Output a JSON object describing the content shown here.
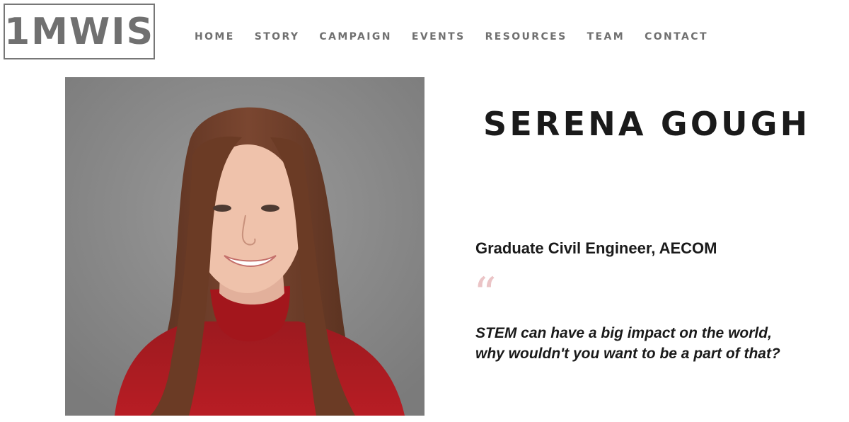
{
  "header": {
    "logo_text": "1MWIS",
    "nav": [
      {
        "label": "HOME"
      },
      {
        "label": "STORY"
      },
      {
        "label": "CAMPAIGN"
      },
      {
        "label": "EVENTS"
      },
      {
        "label": "RESOURCES"
      },
      {
        "label": "TEAM"
      },
      {
        "label": "CONTACT"
      }
    ]
  },
  "profile": {
    "name": "SERENA GOUGH",
    "role": "Graduate Civil Engineer, AECOM",
    "quote_mark": "“",
    "quote_line1": "STEM can have a big impact on the world,",
    "quote_line2": "why wouldn't you want to be a part of that?"
  },
  "colors": {
    "logo_border": "#777777",
    "nav_text": "#707070",
    "heading_text": "#1a1a1a",
    "quote_mark": "#ebc4c6",
    "photo_background": "#8a8a8a",
    "sweater": "#a5161c",
    "hair": "#6e3e26"
  }
}
